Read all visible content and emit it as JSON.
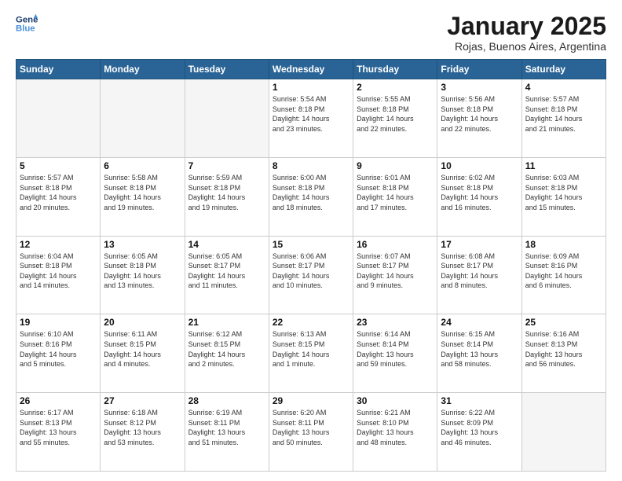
{
  "header": {
    "logo_line1": "General",
    "logo_line2": "Blue",
    "title": "January 2025",
    "subtitle": "Rojas, Buenos Aires, Argentina"
  },
  "days_of_week": [
    "Sunday",
    "Monday",
    "Tuesday",
    "Wednesday",
    "Thursday",
    "Friday",
    "Saturday"
  ],
  "weeks": [
    [
      {
        "day": "",
        "info": ""
      },
      {
        "day": "",
        "info": ""
      },
      {
        "day": "",
        "info": ""
      },
      {
        "day": "1",
        "info": "Sunrise: 5:54 AM\nSunset: 8:18 PM\nDaylight: 14 hours\nand 23 minutes."
      },
      {
        "day": "2",
        "info": "Sunrise: 5:55 AM\nSunset: 8:18 PM\nDaylight: 14 hours\nand 22 minutes."
      },
      {
        "day": "3",
        "info": "Sunrise: 5:56 AM\nSunset: 8:18 PM\nDaylight: 14 hours\nand 22 minutes."
      },
      {
        "day": "4",
        "info": "Sunrise: 5:57 AM\nSunset: 8:18 PM\nDaylight: 14 hours\nand 21 minutes."
      }
    ],
    [
      {
        "day": "5",
        "info": "Sunrise: 5:57 AM\nSunset: 8:18 PM\nDaylight: 14 hours\nand 20 minutes."
      },
      {
        "day": "6",
        "info": "Sunrise: 5:58 AM\nSunset: 8:18 PM\nDaylight: 14 hours\nand 19 minutes."
      },
      {
        "day": "7",
        "info": "Sunrise: 5:59 AM\nSunset: 8:18 PM\nDaylight: 14 hours\nand 19 minutes."
      },
      {
        "day": "8",
        "info": "Sunrise: 6:00 AM\nSunset: 8:18 PM\nDaylight: 14 hours\nand 18 minutes."
      },
      {
        "day": "9",
        "info": "Sunrise: 6:01 AM\nSunset: 8:18 PM\nDaylight: 14 hours\nand 17 minutes."
      },
      {
        "day": "10",
        "info": "Sunrise: 6:02 AM\nSunset: 8:18 PM\nDaylight: 14 hours\nand 16 minutes."
      },
      {
        "day": "11",
        "info": "Sunrise: 6:03 AM\nSunset: 8:18 PM\nDaylight: 14 hours\nand 15 minutes."
      }
    ],
    [
      {
        "day": "12",
        "info": "Sunrise: 6:04 AM\nSunset: 8:18 PM\nDaylight: 14 hours\nand 14 minutes."
      },
      {
        "day": "13",
        "info": "Sunrise: 6:05 AM\nSunset: 8:18 PM\nDaylight: 14 hours\nand 13 minutes."
      },
      {
        "day": "14",
        "info": "Sunrise: 6:05 AM\nSunset: 8:17 PM\nDaylight: 14 hours\nand 11 minutes."
      },
      {
        "day": "15",
        "info": "Sunrise: 6:06 AM\nSunset: 8:17 PM\nDaylight: 14 hours\nand 10 minutes."
      },
      {
        "day": "16",
        "info": "Sunrise: 6:07 AM\nSunset: 8:17 PM\nDaylight: 14 hours\nand 9 minutes."
      },
      {
        "day": "17",
        "info": "Sunrise: 6:08 AM\nSunset: 8:17 PM\nDaylight: 14 hours\nand 8 minutes."
      },
      {
        "day": "18",
        "info": "Sunrise: 6:09 AM\nSunset: 8:16 PM\nDaylight: 14 hours\nand 6 minutes."
      }
    ],
    [
      {
        "day": "19",
        "info": "Sunrise: 6:10 AM\nSunset: 8:16 PM\nDaylight: 14 hours\nand 5 minutes."
      },
      {
        "day": "20",
        "info": "Sunrise: 6:11 AM\nSunset: 8:15 PM\nDaylight: 14 hours\nand 4 minutes."
      },
      {
        "day": "21",
        "info": "Sunrise: 6:12 AM\nSunset: 8:15 PM\nDaylight: 14 hours\nand 2 minutes."
      },
      {
        "day": "22",
        "info": "Sunrise: 6:13 AM\nSunset: 8:15 PM\nDaylight: 14 hours\nand 1 minute."
      },
      {
        "day": "23",
        "info": "Sunrise: 6:14 AM\nSunset: 8:14 PM\nDaylight: 13 hours\nand 59 minutes."
      },
      {
        "day": "24",
        "info": "Sunrise: 6:15 AM\nSunset: 8:14 PM\nDaylight: 13 hours\nand 58 minutes."
      },
      {
        "day": "25",
        "info": "Sunrise: 6:16 AM\nSunset: 8:13 PM\nDaylight: 13 hours\nand 56 minutes."
      }
    ],
    [
      {
        "day": "26",
        "info": "Sunrise: 6:17 AM\nSunset: 8:13 PM\nDaylight: 13 hours\nand 55 minutes."
      },
      {
        "day": "27",
        "info": "Sunrise: 6:18 AM\nSunset: 8:12 PM\nDaylight: 13 hours\nand 53 minutes."
      },
      {
        "day": "28",
        "info": "Sunrise: 6:19 AM\nSunset: 8:11 PM\nDaylight: 13 hours\nand 51 minutes."
      },
      {
        "day": "29",
        "info": "Sunrise: 6:20 AM\nSunset: 8:11 PM\nDaylight: 13 hours\nand 50 minutes."
      },
      {
        "day": "30",
        "info": "Sunrise: 6:21 AM\nSunset: 8:10 PM\nDaylight: 13 hours\nand 48 minutes."
      },
      {
        "day": "31",
        "info": "Sunrise: 6:22 AM\nSunset: 8:09 PM\nDaylight: 13 hours\nand 46 minutes."
      },
      {
        "day": "",
        "info": ""
      }
    ]
  ]
}
